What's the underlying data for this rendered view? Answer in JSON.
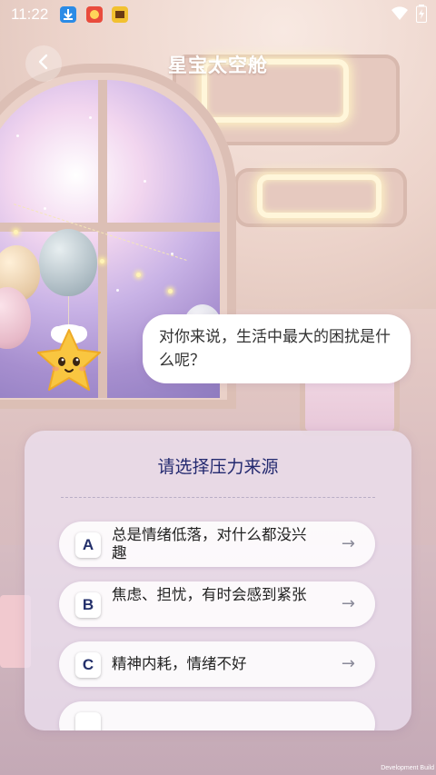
{
  "status_bar": {
    "time": "11:22",
    "icons": [
      "download-icon",
      "app-red-icon",
      "app-yellow-icon"
    ],
    "right_icons": [
      "wifi-icon",
      "battery-icon"
    ]
  },
  "header": {
    "title": "星宝太空舱",
    "back_icon": "chevron-left-icon"
  },
  "dialog": {
    "question": "对你来说，生活中最大的困扰是什么呢？"
  },
  "panel": {
    "title": "请选择压力来源",
    "options": [
      {
        "letter": "A",
        "text": "总是情绪低落，对什么都没兴趣"
      },
      {
        "letter": "B",
        "text": "焦虑、担忧，有时会感到紧张"
      },
      {
        "letter": "C",
        "text": "精神内耗，情绪不好"
      },
      {
        "letter": "",
        "text": ""
      }
    ],
    "arrow": "→"
  },
  "footer": {
    "dev_build": "Development Build"
  },
  "colors": {
    "title_navy": "#242a70",
    "panel_bg": "#ece0f0",
    "bubble_bg": "#ffffff"
  }
}
